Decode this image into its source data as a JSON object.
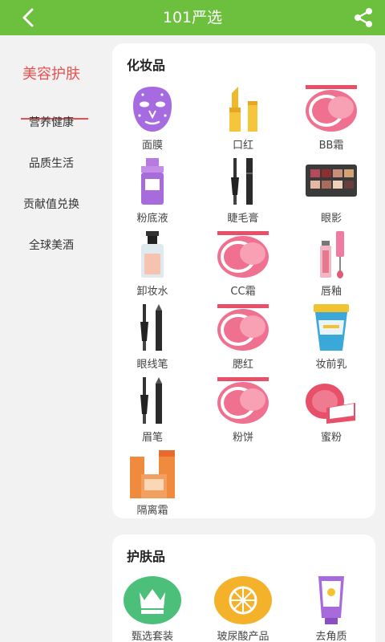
{
  "header": {
    "title": "101严选",
    "back_icon": "back-arrow-icon",
    "share_icon": "share-icon",
    "bg_color": "#6dbf3e"
  },
  "sidebar": {
    "accent_color": "#e8504f",
    "items": [
      {
        "label": "美容护肤",
        "active": true
      },
      {
        "label": "营养健康",
        "active": false
      },
      {
        "label": "品质生活",
        "active": false
      },
      {
        "label": "贡献值兑换",
        "active": false
      },
      {
        "label": "全球美酒",
        "active": false
      }
    ]
  },
  "sections": [
    {
      "title": "化妆品",
      "items": [
        {
          "label": "面膜",
          "icon": "face-mask-icon"
        },
        {
          "label": "口红",
          "icon": "lipstick-icon"
        },
        {
          "label": "BB霜",
          "icon": "compact-icon"
        },
        {
          "label": "粉底液",
          "icon": "foundation-bottle-icon"
        },
        {
          "label": "睫毛膏",
          "icon": "mascara-icon"
        },
        {
          "label": "眼影",
          "icon": "eyeshadow-palette-icon"
        },
        {
          "label": "卸妆水",
          "icon": "makeup-remover-icon"
        },
        {
          "label": "CC霜",
          "icon": "compact-icon"
        },
        {
          "label": "唇釉",
          "icon": "lip-gloss-icon"
        },
        {
          "label": "眼线笔",
          "icon": "eyeliner-icon"
        },
        {
          "label": "腮红",
          "icon": "compact-icon"
        },
        {
          "label": "妆前乳",
          "icon": "primer-jar-icon"
        },
        {
          "label": "眉笔",
          "icon": "eyebrow-pencil-icon"
        },
        {
          "label": "粉饼",
          "icon": "compact-icon"
        },
        {
          "label": "蜜粉",
          "icon": "loose-powder-icon"
        },
        {
          "label": "隔离霜",
          "icon": "cosmetic-boxes-icon"
        }
      ]
    },
    {
      "title": "护肤品",
      "items": [
        {
          "label": "甄选套装",
          "icon": "crown-badge-icon"
        },
        {
          "label": "玻尿酸产品",
          "icon": "citrus-badge-icon"
        },
        {
          "label": "去角质",
          "icon": "exfoliant-tube-icon"
        }
      ]
    }
  ]
}
